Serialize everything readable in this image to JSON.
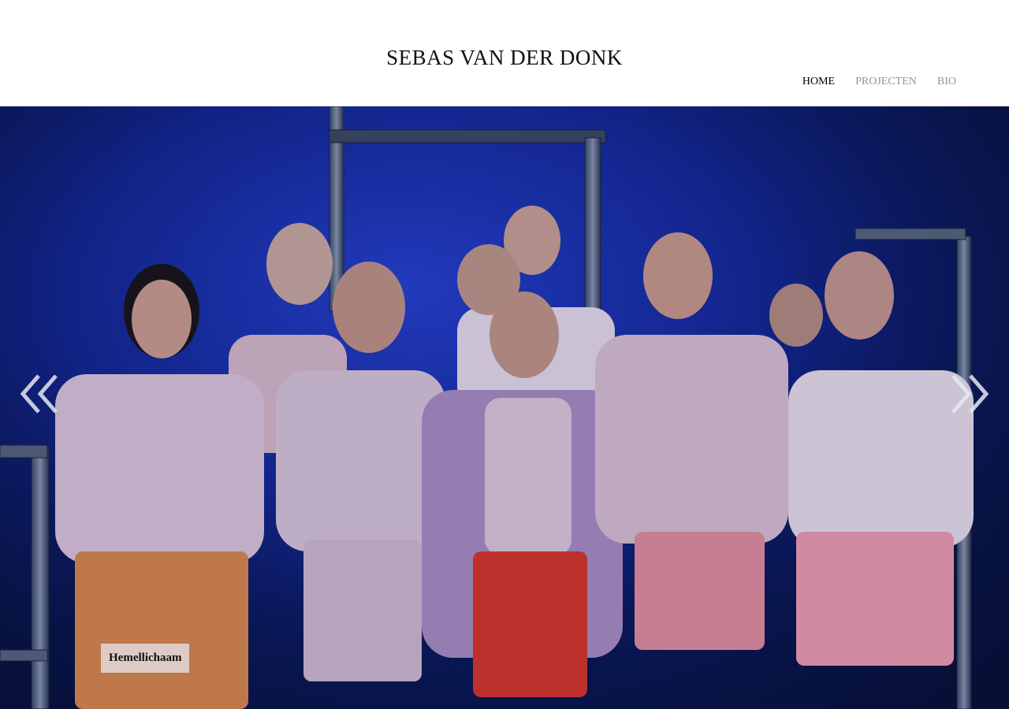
{
  "site": {
    "title": "SEBAS VAN DER DONK"
  },
  "nav": {
    "items": [
      {
        "label": "HOME",
        "active": true
      },
      {
        "label": "PROJECTEN",
        "active": false
      },
      {
        "label": "BIO",
        "active": false
      }
    ]
  },
  "slider": {
    "caption": "Hemellichaam",
    "prev_icon": "double-chevron-left-icon",
    "next_icon": "double-chevron-right-icon"
  },
  "colors": {
    "nav_active": "#000000",
    "nav_inactive": "#9a9484",
    "stage_blue": "#1c36b8",
    "caption_bg": "#e2d6d6"
  }
}
